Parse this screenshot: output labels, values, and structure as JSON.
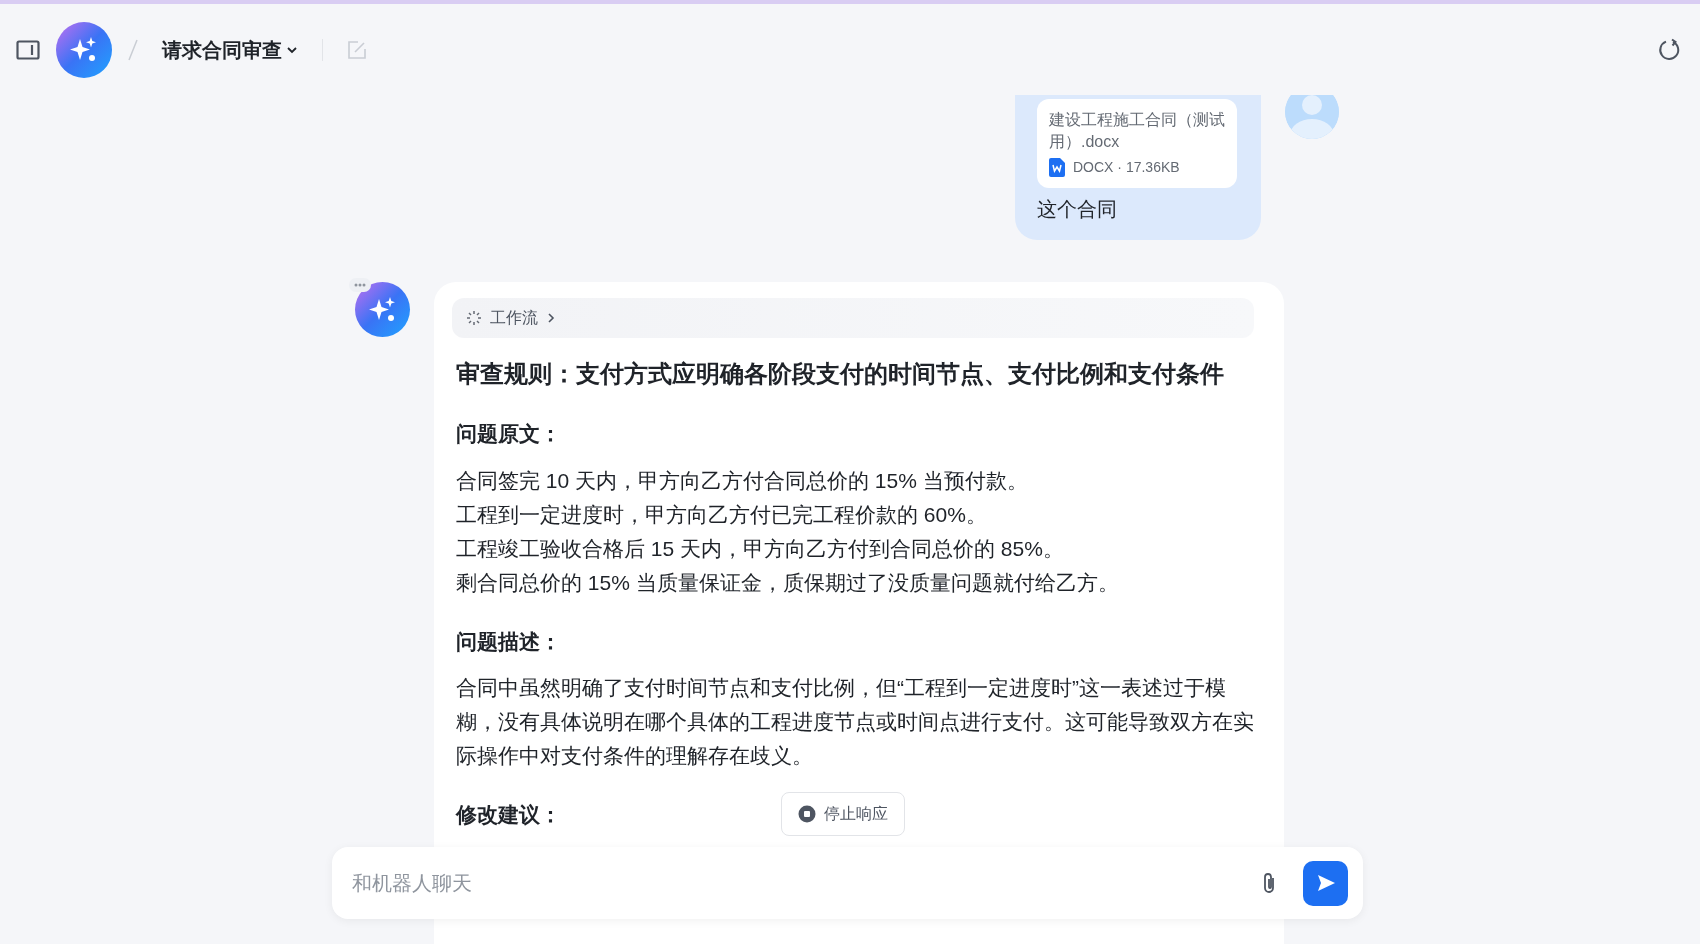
{
  "header": {
    "title": "请求合同审查"
  },
  "messages": [
    {
      "kind": "user",
      "attachment": {
        "file_name": "建设工程施工合同（测试用）.docx",
        "meta": "DOCX · 17.36KB"
      },
      "text": "这个合同"
    },
    {
      "kind": "assistant",
      "workflow": {
        "label": "工作流",
        "expanded": false
      },
      "title": "审查规则：支付方式应明确各阶段支付的时间节点、支付比例和支付条件",
      "sections": [
        {
          "heading": "问题原文：",
          "lines": [
            "合同签完 10 天内，甲方向乙方付合同总价的 15% 当预付款。",
            "工程到一定进度时，甲方向乙方付已完工程价款的 60%。",
            "工程竣工验收合格后 15 天内，甲方向乙方付到合同总价的 85%。",
            "剩合同总价的 15% 当质量保证金，质保期过了没质量问题就付给乙方。"
          ]
        },
        {
          "heading": "问题描述：",
          "lines": [
            "合同中虽然明确了支付时间节点和支付比例，但“工程到一定进度时”这一表述过于模糊，没有具体说明在哪个具体的工程进度节点或时间点进行支付。这可能导致双方在实际操作中对支付条件的理解存在歧义。"
          ]
        },
        {
          "heading": "修改建议："
        }
      ]
    }
  ],
  "stop_button": {
    "label": "停止响应"
  },
  "composer": {
    "placeholder": "和机器人聊天"
  }
}
